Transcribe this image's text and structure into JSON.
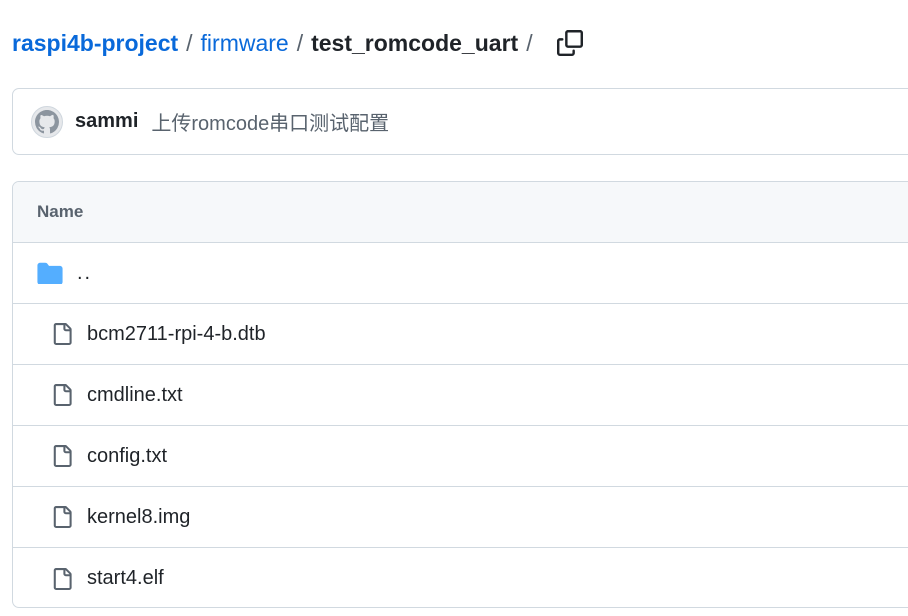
{
  "breadcrumb": {
    "repo": "raspi4b-project",
    "separator": "/",
    "folder": "firmware",
    "current": "test_romcode_uart",
    "copy_icon": "copy-icon"
  },
  "commit": {
    "avatar_icon": "github-avatar-icon",
    "author": "sammi",
    "message": "上传romcode串口测试配置"
  },
  "table": {
    "header": "Name",
    "parent_row": {
      "label": "..",
      "icon": "folder-icon",
      "icon_color": "#54aeff"
    },
    "files": [
      {
        "name": "bcm2711-rpi-4-b.dtb",
        "icon": "file-icon"
      },
      {
        "name": "cmdline.txt",
        "icon": "file-icon"
      },
      {
        "name": "config.txt",
        "icon": "file-icon"
      },
      {
        "name": "kernel8.img",
        "icon": "file-icon"
      },
      {
        "name": "start4.elf",
        "icon": "file-icon"
      }
    ]
  },
  "colors": {
    "link": "#0969da",
    "border": "#d1d9e0",
    "header_bg": "#f6f8fa",
    "muted_text": "#59636e"
  }
}
